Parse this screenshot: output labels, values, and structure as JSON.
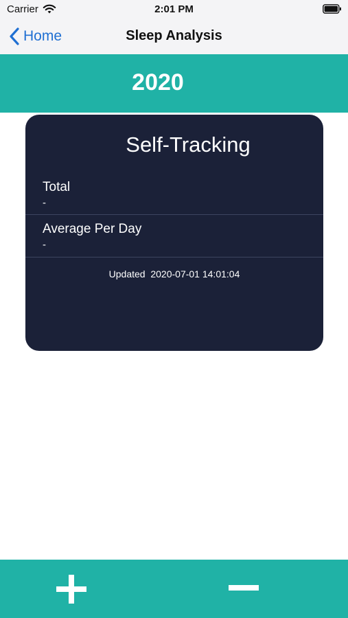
{
  "status_bar": {
    "carrier": "Carrier",
    "time": "2:01 PM",
    "wifi_icon": "wifi-icon",
    "battery_icon": "battery-icon"
  },
  "nav": {
    "back_label": "Home",
    "back_icon": "chevron-left-icon",
    "title": "Sleep Analysis"
  },
  "banner": {
    "year": "2020",
    "color": "#20b2a6"
  },
  "card": {
    "title": "Self-Tracking",
    "rows": [
      {
        "label": "Total",
        "value": "-"
      },
      {
        "label": "Average Per Day",
        "value": "-"
      }
    ],
    "updated": "Updated  2020-07-01 14:01:04",
    "background": "#1b2138"
  },
  "bottom_bar": {
    "add_icon": "plus-icon",
    "remove_icon": "minus-icon"
  }
}
